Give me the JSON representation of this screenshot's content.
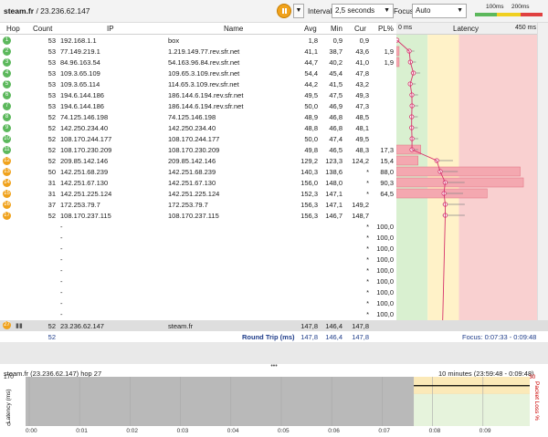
{
  "toolbar": {
    "target_host": "steam.fr",
    "target_sep": " / ",
    "target_ip": "23.236.62.147",
    "interval_label": "Interval",
    "interval_value": "2,5 seconds",
    "focus_label": "Focus",
    "focus_value": "Auto",
    "legend_100": "100ms",
    "legend_200": "200ms",
    "pause_icon": "pause-icon",
    "dropdown_icon": "chevron-down-icon"
  },
  "columns": {
    "hop": "Hop",
    "count": "Count",
    "ip": "IP",
    "name": "Name",
    "avg": "Avg",
    "min": "Min",
    "cur": "Cur",
    "pl": "PL%",
    "latency_0": "0 ms",
    "latency": "Latency",
    "latency_max": "450 ms"
  },
  "rows": [
    {
      "hop": "1",
      "count": "53",
      "ip": "192.168.1.1",
      "name": "box",
      "avg": "1,8",
      "min": "0,9",
      "cur": "0,9",
      "pl": "",
      "c": "g"
    },
    {
      "hop": "2",
      "count": "53",
      "ip": "77.149.219.1",
      "name": "1.219.149.77.rev.sfr.net",
      "avg": "41,1",
      "min": "38,7",
      "cur": "43,6",
      "pl": "1,9",
      "c": "g"
    },
    {
      "hop": "3",
      "count": "53",
      "ip": "84.96.163.54",
      "name": "54.163.96.84.rev.sfr.net",
      "avg": "44,7",
      "min": "40,2",
      "cur": "41,0",
      "pl": "1,9",
      "c": "g"
    },
    {
      "hop": "4",
      "count": "53",
      "ip": "109.3.65.109",
      "name": "109.65.3.109.rev.sfr.net",
      "avg": "54,4",
      "min": "45,4",
      "cur": "47,8",
      "pl": "",
      "c": "g"
    },
    {
      "hop": "5",
      "count": "53",
      "ip": "109.3.65.114",
      "name": "114.65.3.109.rev.sfr.net",
      "avg": "44,2",
      "min": "41,5",
      "cur": "43,2",
      "pl": "",
      "c": "g"
    },
    {
      "hop": "6",
      "count": "53",
      "ip": "194.6.144.186",
      "name": "186.144.6.194.rev.sfr.net",
      "avg": "49,5",
      "min": "47,5",
      "cur": "49,3",
      "pl": "",
      "c": "g"
    },
    {
      "hop": "7",
      "count": "53",
      "ip": "194.6.144.186",
      "name": "186.144.6.194.rev.sfr.net",
      "avg": "50,0",
      "min": "46,9",
      "cur": "47,3",
      "pl": "",
      "c": "g"
    },
    {
      "hop": "8",
      "count": "52",
      "ip": "74.125.146.198",
      "name": "74.125.146.198",
      "avg": "48,9",
      "min": "46,8",
      "cur": "48,5",
      "pl": "",
      "c": "g"
    },
    {
      "hop": "9",
      "count": "52",
      "ip": "142.250.234.40",
      "name": "142.250.234.40",
      "avg": "48,8",
      "min": "46,8",
      "cur": "48,1",
      "pl": "",
      "c": "g"
    },
    {
      "hop": "10",
      "count": "52",
      "ip": "108.170.244.177",
      "name": "108.170.244.177",
      "avg": "50,0",
      "min": "47,4",
      "cur": "49,5",
      "pl": "",
      "c": "g"
    },
    {
      "hop": "11",
      "count": "52",
      "ip": "108.170.230.209",
      "name": "108.170.230.209",
      "avg": "49,8",
      "min": "46,5",
      "cur": "48,3",
      "pl": "17,3",
      "c": "g"
    },
    {
      "hop": "12",
      "count": "52",
      "ip": "209.85.142.146",
      "name": "209.85.142.146",
      "avg": "129,2",
      "min": "123,3",
      "cur": "124,2",
      "pl": "15,4",
      "c": "o"
    },
    {
      "hop": "13",
      "count": "50",
      "ip": "142.251.68.239",
      "name": "142.251.68.239",
      "avg": "140,3",
      "min": "138,6",
      "cur": "*",
      "pl": "88,0",
      "c": "o"
    },
    {
      "hop": "14",
      "count": "31",
      "ip": "142.251.67.130",
      "name": "142.251.67.130",
      "avg": "156,0",
      "min": "148,0",
      "cur": "*",
      "pl": "90,3",
      "c": "o"
    },
    {
      "hop": "15",
      "count": "31",
      "ip": "142.251.225.124",
      "name": "142.251.225.124",
      "avg": "152,3",
      "min": "147,1",
      "cur": "*",
      "pl": "64,5",
      "c": "o"
    },
    {
      "hop": "16",
      "count": "37",
      "ip": "172.253.79.7",
      "name": "172.253.79.7",
      "avg": "156,3",
      "min": "147,1",
      "cur": "149,2",
      "pl": "",
      "c": "o"
    },
    {
      "hop": "17",
      "count": "52",
      "ip": "108.170.237.115",
      "name": "108.170.237.115",
      "avg": "156,3",
      "min": "146,7",
      "cur": "148,7",
      "pl": "",
      "c": "o"
    },
    {
      "hop": "",
      "count": "",
      "ip": "-",
      "name": "",
      "avg": "",
      "min": "",
      "cur": "*",
      "pl": "100,0",
      "c": ""
    },
    {
      "hop": "",
      "count": "",
      "ip": "-",
      "name": "",
      "avg": "",
      "min": "",
      "cur": "*",
      "pl": "100,0",
      "c": ""
    },
    {
      "hop": "",
      "count": "",
      "ip": "-",
      "name": "",
      "avg": "",
      "min": "",
      "cur": "*",
      "pl": "100,0",
      "c": ""
    },
    {
      "hop": "",
      "count": "",
      "ip": "-",
      "name": "",
      "avg": "",
      "min": "",
      "cur": "*",
      "pl": "100,0",
      "c": ""
    },
    {
      "hop": "",
      "count": "",
      "ip": "-",
      "name": "",
      "avg": "",
      "min": "",
      "cur": "*",
      "pl": "100,0",
      "c": ""
    },
    {
      "hop": "",
      "count": "",
      "ip": "-",
      "name": "",
      "avg": "",
      "min": "",
      "cur": "*",
      "pl": "100,0",
      "c": ""
    },
    {
      "hop": "",
      "count": "",
      "ip": "-",
      "name": "",
      "avg": "",
      "min": "",
      "cur": "*",
      "pl": "100,0",
      "c": ""
    },
    {
      "hop": "",
      "count": "",
      "ip": "-",
      "name": "",
      "avg": "",
      "min": "",
      "cur": "*",
      "pl": "100,0",
      "c": ""
    },
    {
      "hop": "",
      "count": "",
      "ip": "-",
      "name": "",
      "avg": "",
      "min": "",
      "cur": "*",
      "pl": "100,0",
      "c": ""
    }
  ],
  "summary": {
    "hop": "27",
    "count": "52",
    "ip": "23.236.62.147",
    "name": "steam.fr",
    "avg": "147,8",
    "min": "146,4",
    "cur": "147,8",
    "round_trip_label": "Round Trip (ms)",
    "round_avg": "147,8",
    "round_min": "146,4",
    "round_cur": "147,8",
    "round_count": "52",
    "focus_text": "Focus: 0:07:33 - 0:09:48"
  },
  "bottom": {
    "title": "steam.fr (23.236.62.147) hop 27",
    "range": "10 minutes (23:59:48 - 0:09:48)",
    "y_left": "Latency (ms)",
    "y_right": "Packet Loss %",
    "y_top": "170",
    "y_bot": "0",
    "y_right_top": "30",
    "ticks": [
      "0:00",
      "0:01",
      "0:02",
      "0:03",
      "0:04",
      "0:05",
      "0:06",
      "0:07",
      "0:08",
      "0:09"
    ]
  },
  "colors": {
    "ok": "#5cb85c",
    "warn": "#f0a21c",
    "zone_green": "#d9f0d0",
    "zone_yellow": "#fff2c8",
    "zone_red": "#f9d0d0",
    "line": "#d6336c"
  }
}
